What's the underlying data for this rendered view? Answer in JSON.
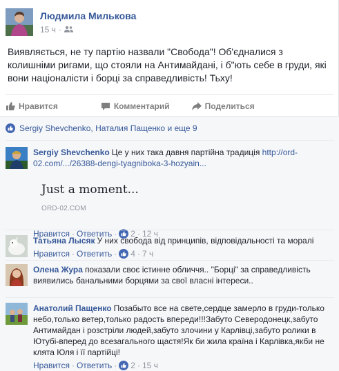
{
  "post": {
    "author": "Людмила Милькова",
    "time": "15 ч",
    "audience_icon": "friends-icon",
    "text": "Виявляється, не ту партію назвали \"Свобода\"! Об'єдналися з колишніми ригами, що стояли на Антимайдані, і б\"ють себе в груди, які вони націоналісти і борці за справедливість! Тьху!"
  },
  "actions": {
    "like": "Нравится",
    "comment": "Комментарий",
    "share": "Поделиться"
  },
  "likes": {
    "text": "Sergiy Shevchenko, Наталия Пащенко и еще 9"
  },
  "comments": [
    {
      "name": "Sergiy Shevchenko",
      "text": "Це у них така давня партійна традиція ",
      "link": "http://ord-02.com/.../26388-dengi-tyagniboka-3-hozyain...",
      "preview_title": "Just a moment...",
      "preview_domain": "ORD-02.COM",
      "like_label": "Нравится",
      "reply_label": "Ответить",
      "likes": "2",
      "time": "12 ч"
    },
    {
      "name": "Татьяна Лысяк",
      "text": "У них свобода від принципів, відповідальності та моралі",
      "like_label": "Нравится",
      "reply_label": "Ответить",
      "likes": "4",
      "time": "7 ч"
    },
    {
      "name": "Олена Жура",
      "text": "показали своє істинне обличчя.. \"Борці\" за справедливість виявились банальними борцями за свої власні інтереси..",
      "like_label": "Нравится",
      "reply_label": "Ответить",
      "likes": "",
      "time": ""
    },
    {
      "name": "Анатолий Пащенко",
      "text": "Позабыто все на свете,сердце замерло в груди-только небо,только ветер,только радость впереди!!!Забуто Северодонецк,забуто Антимайдан і розстріли людей,забуто злочини у Карлівці,забуто ролики в Ютубі-вперед до всезагального щастя!Як би жила країна і Карлівка,якби не клята Юля і її партійці!",
      "like_label": "Нравится",
      "reply_label": "Ответить",
      "likes": "2",
      "time": "15 ч"
    }
  ],
  "colors": {
    "link": "#365899",
    "meta": "#90949c",
    "like_blue": "#4267b2",
    "ufi_bg": "#f6f7f9"
  }
}
